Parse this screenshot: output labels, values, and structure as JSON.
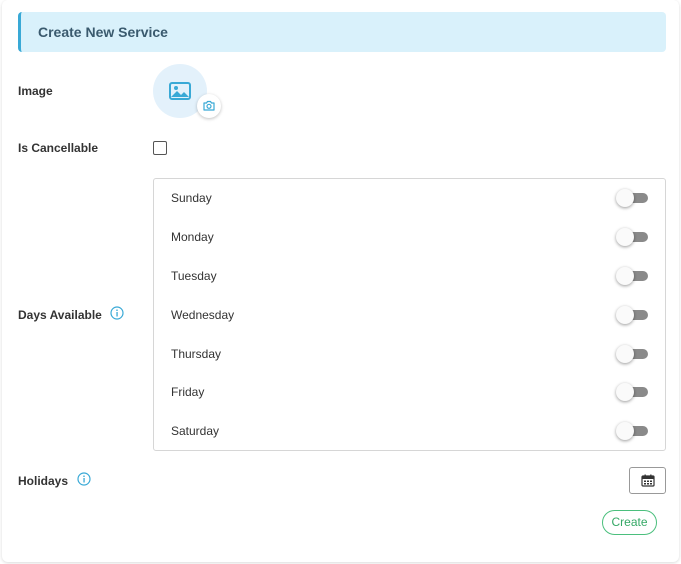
{
  "header": {
    "title": "Create New Service"
  },
  "form": {
    "image_label": "Image",
    "cancellable_label": "Is Cancellable",
    "days_label": "Days Available",
    "holidays_label": "Holidays",
    "is_cancellable": false
  },
  "days": [
    {
      "label": "Sunday",
      "enabled": false
    },
    {
      "label": "Monday",
      "enabled": false
    },
    {
      "label": "Tuesday",
      "enabled": false
    },
    {
      "label": "Wednesday",
      "enabled": false
    },
    {
      "label": "Thursday",
      "enabled": false
    },
    {
      "label": "Friday",
      "enabled": false
    },
    {
      "label": "Saturday",
      "enabled": false
    }
  ],
  "actions": {
    "create_label": "Create"
  },
  "icons": {
    "image_placeholder": "image-icon",
    "camera": "camera-icon",
    "info": "info-icon",
    "calendar": "calendar-icon"
  },
  "colors": {
    "accent": "#39a9d6",
    "header_bg": "#d9f1fb",
    "create_green": "#34a865"
  }
}
